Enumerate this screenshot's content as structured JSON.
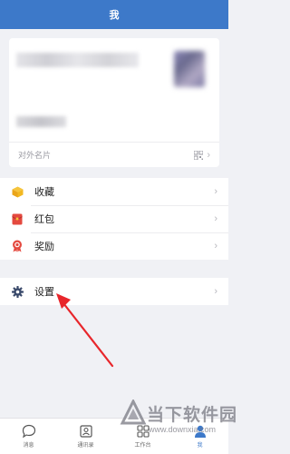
{
  "header": {
    "title": "我"
  },
  "profile_card": {
    "card_label": "对外名片"
  },
  "menu_group_1": [
    {
      "label": "收藏",
      "icon": "favorites-cube-icon",
      "color": "#f2b822"
    },
    {
      "label": "红包",
      "icon": "red-envelope-icon",
      "color": "#e4493f"
    },
    {
      "label": "奖励",
      "icon": "award-ribbon-icon",
      "color": "#e4493f"
    }
  ],
  "menu_group_2": [
    {
      "label": "设置",
      "icon": "gear-icon",
      "color": "#3a4a6b"
    }
  ],
  "tabbar": [
    {
      "label": "消息",
      "icon": "chat-bubble-icon",
      "active": false
    },
    {
      "label": "通讯录",
      "icon": "contacts-icon",
      "active": false
    },
    {
      "label": "工作台",
      "icon": "grid-workbench-icon",
      "active": false
    },
    {
      "label": "我",
      "icon": "person-icon",
      "active": true
    }
  ],
  "watermark": {
    "title": "当下软件园",
    "url": "www.downxia.com"
  },
  "colors": {
    "header_bg": "#3d79c9",
    "annotation_arrow": "#e8262b"
  }
}
